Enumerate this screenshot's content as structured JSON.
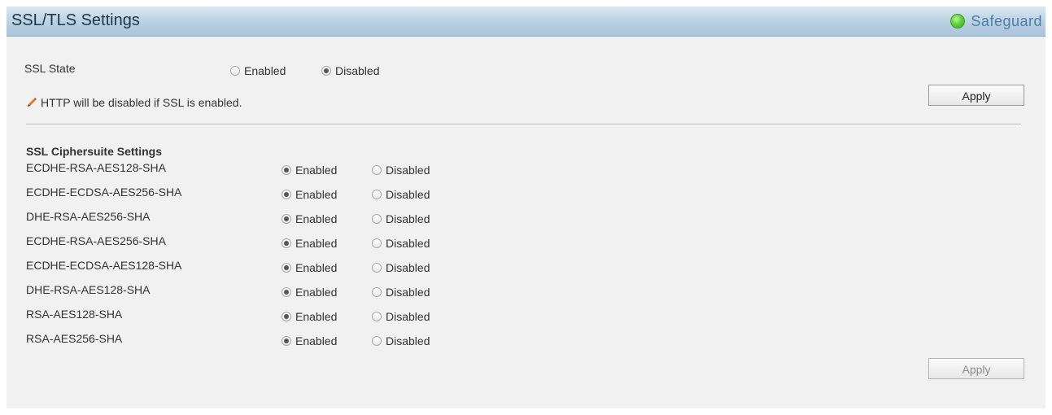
{
  "header": {
    "title": "SSL/TLS Settings",
    "safeguard_label": "Safeguard",
    "status_color": "#4fce2f"
  },
  "ssl_state": {
    "label": "SSL State",
    "options": [
      "Enabled",
      "Disabled"
    ],
    "selected": "Disabled",
    "note": "HTTP will be disabled if SSL is enabled.",
    "apply_label": "Apply"
  },
  "ciphersuite": {
    "title": "SSL Ciphersuite Settings",
    "options": [
      "Enabled",
      "Disabled"
    ],
    "rows": [
      {
        "name": "ECDHE-RSA-AES128-SHA",
        "selected": "Enabled"
      },
      {
        "name": "ECDHE-ECDSA-AES256-SHA",
        "selected": "Enabled"
      },
      {
        "name": "DHE-RSA-AES256-SHA",
        "selected": "Enabled"
      },
      {
        "name": "ECDHE-RSA-AES256-SHA",
        "selected": "Enabled"
      },
      {
        "name": "ECDHE-ECDSA-AES128-SHA",
        "selected": "Enabled"
      },
      {
        "name": "DHE-RSA-AES128-SHA",
        "selected": "Enabled"
      },
      {
        "name": "RSA-AES128-SHA",
        "selected": "Enabled"
      },
      {
        "name": "RSA-AES256-SHA",
        "selected": "Enabled"
      }
    ],
    "apply_label": "Apply"
  }
}
